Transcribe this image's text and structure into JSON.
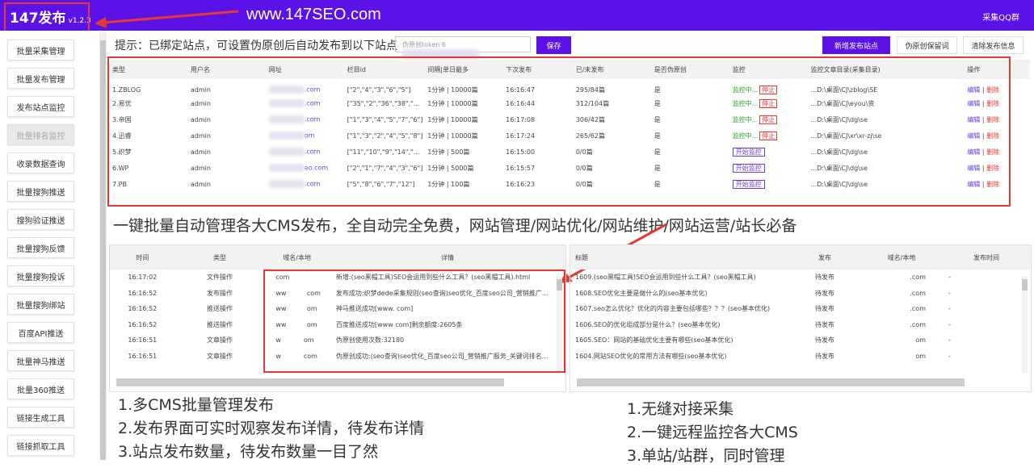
{
  "header": {
    "app": "147发布",
    "version": "v1.2.3",
    "promo_url": "www.147SEO.com",
    "qq_link": "采集QQ群"
  },
  "sidebar": {
    "items": [
      {
        "label": "批量采集管理",
        "disabled": false
      },
      {
        "label": "批量发布管理",
        "disabled": false
      },
      {
        "label": "发布站点监控",
        "disabled": false
      },
      {
        "label": "批量排名监控",
        "disabled": true
      },
      {
        "label": "收录数据查询",
        "disabled": false
      },
      {
        "label": "批量搜狗推送",
        "disabled": false
      },
      {
        "label": "搜狗验证推送",
        "disabled": false
      },
      {
        "label": "批量搜狗反馈",
        "disabled": false
      },
      {
        "label": "批量搜狗投诉",
        "disabled": false
      },
      {
        "label": "批量搜狗绑站",
        "disabled": false
      },
      {
        "label": "百度API推送",
        "disabled": false
      },
      {
        "label": "批量神马推送",
        "disabled": false
      },
      {
        "label": "批量360推送",
        "disabled": false
      },
      {
        "label": "链接生成工具",
        "disabled": false
      },
      {
        "label": "链接抓取工具",
        "disabled": false
      }
    ]
  },
  "toolbar": {
    "tip": "提示：已绑定站点，可设置伪原创后自动发布到以下站点",
    "token_label": "伪原创token",
    "token_value": "6",
    "save": "保存",
    "add_site": "新增发布站点",
    "keep_words": "伪原创保留词",
    "clear_info": "清除发布信息"
  },
  "sites": {
    "columns": [
      "类型",
      "用户名",
      "网址",
      "栏目id",
      "间隔|单日最多",
      "下次发布",
      "已/未发布",
      "是否伪原创",
      "监控",
      "监控文章目录(采集目录)",
      "操作"
    ],
    "monitoring_label": "监控中...",
    "stop_label": "停止",
    "start_label": "开始监控",
    "edit": "编辑",
    "delete": "删除",
    "rows": [
      {
        "type": "1.ZBLOG",
        "user": "admin",
        "url": ".com",
        "cat": "[\"2\",\"4\",\"3\",\"6\",\"5\"]",
        "interval": "1分钟 | 10000篇",
        "next": "16:16:47",
        "count": "295/84篇",
        "pseudo": "是",
        "monitoring": true,
        "dir": "...D:\\桌面\\CJ\\zblog\\SE"
      },
      {
        "type": "2.易优",
        "user": "admin",
        "url": ".com",
        "cat": "[\"35\",\"2\",\"36\",\"38\",\"...",
        "interval": "1分钟 | 10000篇",
        "next": "16:16:44",
        "count": "312/104篇",
        "pseudo": "是",
        "monitoring": true,
        "dir": "...D:\\桌面\\CJ\\eyou\\资"
      },
      {
        "type": "3.帝国",
        "user": "admin",
        "url": ".com",
        "cat": "[\"1\",\"3\",\"4\",\"5\",\"7\",\"6\"]",
        "interval": "1分钟 | 10000篇",
        "next": "16:17:08",
        "count": "306/42篇",
        "pseudo": "是",
        "monitoring": true,
        "dir": "...D:\\桌面\\CJ\\dg\\se"
      },
      {
        "type": "4.迅睿",
        "user": "admin",
        "url": "om",
        "cat": "[\"1\",\"3\",\"2\",\"4\",\"5\",\"8\"]",
        "interval": "1分钟 | 10000篇",
        "next": "16:17:24",
        "count": "265/62篇",
        "pseudo": "是",
        "monitoring": true,
        "dir": "...D:\\桌面\\CJ\\xr\\xr-zj\\se"
      },
      {
        "type": "5.织梦",
        "user": "admin",
        "url": ".com",
        "cat": "[\"11\",\"10\",\"9\",\"14\",\"...",
        "interval": "1分钟 | 500篇",
        "next": "16:15:00",
        "count": "0/0篇",
        "pseudo": "是",
        "monitoring": false,
        "dir": "...D:\\桌面\\CJ\\dg\\se"
      },
      {
        "type": "6.WP",
        "user": "admin",
        "url": "eo.com",
        "cat": "[\"2\",\"1\",\"7\",\"4\",\"3\",\"6\"]",
        "interval": "1分钟 | 5000篇",
        "next": "16:15:57",
        "count": "0/0篇",
        "pseudo": "是",
        "monitoring": false,
        "dir": "...D:\\桌面\\CJ\\dg\\se"
      },
      {
        "type": "7.PB",
        "user": "admin",
        "url": ".com",
        "cat": "[\"5\",\"8\",\"6\",\"7\",\"12\"]",
        "interval": "1分钟 | 100篇",
        "next": "16:16:23",
        "count": "0/0篇",
        "pseudo": "是",
        "monitoring": false,
        "dir": "...D:\\桌面\\CJ\\dg\\se"
      }
    ]
  },
  "headline": "一键批量自动管理各大CMS发布，全自动完全免费，网站管理/网站优化/网站维护/网站运营/站长必备",
  "log": {
    "columns": [
      "时间",
      "类型",
      "域名/本地",
      "详情"
    ],
    "rows": [
      {
        "time": "16:17:02",
        "type": "文件操作",
        "domain": "com",
        "detail": "新增:(seo黑帽工具)SEO会运用到些什么工具？(seo黑帽工具).html"
      },
      {
        "time": "16:16:52",
        "type": "发布操作",
        "domain": "ww          com",
        "detail": "发布成功:织梦dede采集规则(seo查询)seo优化_百度seo公司_营销推广..."
      },
      {
        "time": "16:16:52",
        "type": "推送操作",
        "domain": "ww          om",
        "detail": "神马推送成功[www.        com]"
      },
      {
        "time": "16:16:52",
        "type": "推送操作",
        "domain": "ww          om",
        "detail": "百度推送成功[www         com]剩余额度:2605条"
      },
      {
        "time": "16:16:51",
        "type": "文章操作",
        "domain": "w           om",
        "detail": "伪原创使用次数:32180"
      },
      {
        "time": "16:16:51",
        "type": "文章操作",
        "domain": "w           com",
        "detail": "伪原创成功:(seo查询)seo优化_百度seo公司_营销推广服务_关键词排名..."
      }
    ]
  },
  "pending": {
    "columns": [
      "标题",
      "发布",
      "域名/本地",
      "发布时间"
    ],
    "rows": [
      {
        "title": "1609.(seo黑帽工具)SEO会运用到些什么工具？(seo黑帽工具)",
        "status": "待发布",
        "domain": ".com",
        "time": "-"
      },
      {
        "title": "1608.SEO优化主要是做什么的(seo基本优化)",
        "status": "待发布",
        "domain": ".com",
        "time": "-"
      },
      {
        "title": "1607.seo怎么优化？优化的内容主要包括哪些？？？(seo基本优化)",
        "status": "待发布",
        "domain": ".com",
        "time": "-"
      },
      {
        "title": "1606.SEO的优化组成部分是什么？(seo基本优化)",
        "status": "待发布",
        "domain": ".com",
        "time": "-"
      },
      {
        "title": "1605.SEO：网站的基础优化主要有哪些(seo基本优化)",
        "status": "待发布",
        "domain": "om",
        "time": "-"
      },
      {
        "title": "1604.网站SEO优化的常用方法有哪些(seo基本优化)",
        "status": "待发布",
        "domain": "om",
        "time": "-"
      }
    ]
  },
  "notes_left": [
    "1.多CMS批量管理发布",
    "2.发布界面可实时观察发布详情，待发布详情",
    "3.站点发布数量，待发布数量一目了然"
  ],
  "notes_right": [
    "1.无缝对接采集",
    "2.一键远程监控各大CMS",
    "3.单站/站群，同时管理"
  ],
  "colors": {
    "header": "#5b12e6",
    "highlight": "#e53935",
    "link": "#6a3de0"
  }
}
